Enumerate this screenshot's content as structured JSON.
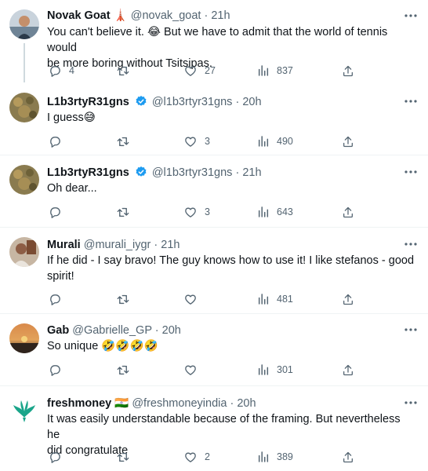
{
  "tweets": [
    {
      "name": "Novak Goat",
      "name_emoji": "🗼",
      "handle": "@novak_goat",
      "time": "21h",
      "text_lines": [
        "You can't believe it. 😂 But we have to admit that the world of tennis would",
        "be more boring without Tsitsipas."
      ],
      "replies": "4",
      "retweets": "",
      "likes": "27",
      "views": "837"
    },
    {
      "name": "L1b3rtyR31gns",
      "handle": "@l1b3rtyr31gns",
      "time": "20h",
      "text_lines": [
        "I guess😅"
      ],
      "replies": "",
      "retweets": "",
      "likes": "3",
      "views": "490"
    },
    {
      "name": "L1b3rtyR31gns",
      "handle": "@l1b3rtyr31gns",
      "time": "21h",
      "text_lines": [
        "Oh dear..."
      ],
      "replies": "",
      "retweets": "",
      "likes": "3",
      "views": "643"
    },
    {
      "name": "Murali",
      "handle": "@murali_iygr",
      "time": "21h",
      "text_lines": [
        "If he did - I say bravo! The guy knows how to use it! I like stefanos - good",
        "spirit!"
      ],
      "replies": "",
      "retweets": "",
      "likes": "",
      "views": "481"
    },
    {
      "name": "Gab",
      "handle": "@Gabrielle_GP",
      "time": "20h",
      "text_lines": [
        "So unique 🤣🤣🤣🤣"
      ],
      "replies": "",
      "retweets": "",
      "likes": "",
      "views": "301"
    },
    {
      "name": "freshmoney",
      "name_emoji": "🇮🇳",
      "handle": "@freshmoneyindia",
      "time": "20h",
      "text_lines": [
        "It was easily understandable because of the framing. But nevertheless he",
        "did congratulate"
      ],
      "replies": "",
      "retweets": "",
      "likes": "2",
      "views": "389"
    }
  ],
  "separator": "·",
  "colors": {
    "text": "#0f1419",
    "secondary": "#536471",
    "verified": "#1d9bf0",
    "divider": "#eff3f4",
    "thread_line": "#cfd9de"
  },
  "icons": [
    "reply-icon",
    "retweet-icon",
    "like-icon",
    "views-icon",
    "share-icon",
    "more-icon",
    "verified-badge-icon"
  ]
}
